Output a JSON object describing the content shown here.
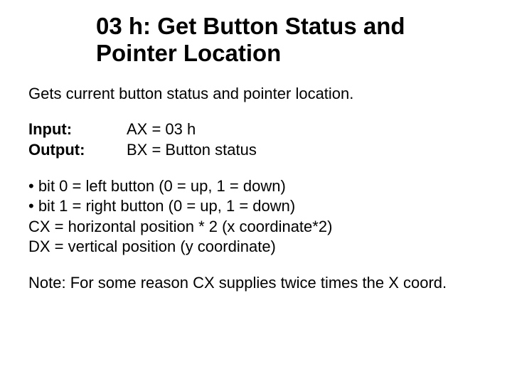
{
  "title_line1": "03 h:  Get Button Status and",
  "title_line2": "Pointer Location",
  "description": "Gets current button status and pointer location.",
  "io": {
    "input_label": "Input:",
    "input_value": " AX = 03 h",
    "output_label": "Output:",
    "output_value": "  BX = Button status"
  },
  "details": {
    "line1": "• bit 0 = left button  (0 = up, 1 = down)",
    "line2": "• bit 1 = right button (0 = up, 1 = down)",
    "line3": "CX = horizontal position * 2   (x coordinate*2)",
    "line4": "DX = vertical position             (y coordinate)"
  },
  "note": "Note: For some reason CX supplies twice times the X coord."
}
